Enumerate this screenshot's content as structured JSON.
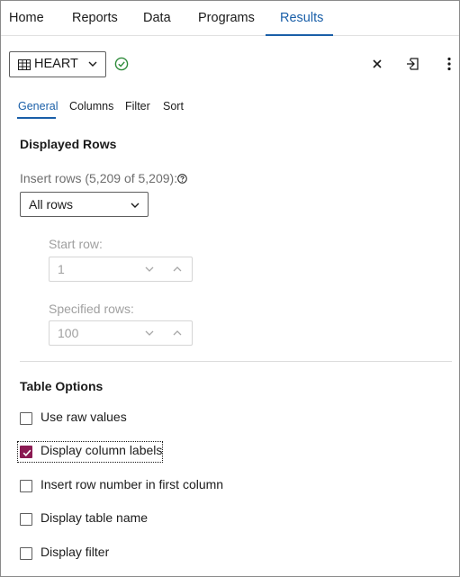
{
  "nav": {
    "items": [
      {
        "label": "Home",
        "active": false
      },
      {
        "label": "Reports",
        "active": false
      },
      {
        "label": "Data",
        "active": false
      },
      {
        "label": "Programs",
        "active": false
      },
      {
        "label": "Results",
        "active": true
      }
    ]
  },
  "toolbar": {
    "table_name": "HEART",
    "status_icon": "check-circle-icon",
    "close_icon": "close-icon",
    "export_icon": "export-icon",
    "more_icon": "more-vertical-icon"
  },
  "tabs": [
    {
      "label": "General",
      "active": true
    },
    {
      "label": "Columns",
      "active": false
    },
    {
      "label": "Filter",
      "active": false
    },
    {
      "label": "Sort",
      "active": false
    }
  ],
  "displayed_rows": {
    "heading": "Displayed Rows",
    "insert_label": "Insert rows (5,209 of 5,209):",
    "select_value": "All rows",
    "start_row_label": "Start row:",
    "start_row_value": "1",
    "specified_rows_label": "Specified rows:",
    "specified_rows_value": "100"
  },
  "table_options": {
    "heading": "Table Options",
    "options": [
      {
        "label": "Use raw values",
        "checked": false
      },
      {
        "label": "Display column labels",
        "checked": true
      },
      {
        "label": "Insert row number in first column",
        "checked": false
      },
      {
        "label": "Display table name",
        "checked": false
      },
      {
        "label": "Display filter",
        "checked": false
      }
    ]
  },
  "colors": {
    "accent": "#1a5fa8",
    "checkbox_checked": "#8b1a52",
    "status_green": "#2e8b3a"
  }
}
